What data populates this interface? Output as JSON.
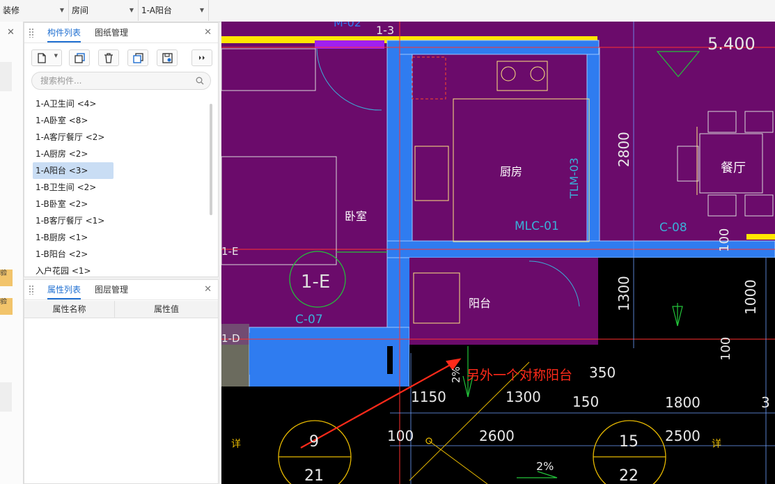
{
  "toolbar": {
    "dropdown1": "装修",
    "dropdown2": "房间",
    "dropdown3": "1-A阳台"
  },
  "left_edge": {
    "tag1": "验",
    "tag2": "验"
  },
  "component_panel": {
    "tab_active": "构件列表",
    "tab_other": "图纸管理",
    "search_placeholder": "搜索构件...",
    "items": [
      "1-A卫生间 <4>",
      "1-A卧室 <8>",
      "1-A客厅餐厅 <2>",
      "1-A厨房 <2>",
      "1-A阳台 <3>",
      "1-B卫生间 <2>",
      "1-B卧室 <2>",
      "1-B客厅餐厅 <1>",
      "1-B厨房 <1>",
      "1-B阳台 <2>",
      "入户花园 <1>"
    ],
    "selected_index": 4
  },
  "property_panel": {
    "tab_active": "属性列表",
    "tab_other": "图层管理",
    "col_name": "属性名称",
    "col_value": "属性值"
  },
  "drawing": {
    "labels": {
      "axis_13": "1-3",
      "axis_1e": "1-E",
      "axis_1d": "1-D",
      "circle_1e": "1-E",
      "elev": "5.400",
      "bedroom": "卧室",
      "kitchen": "厨房",
      "dining": "餐厅",
      "balcony": "阳台",
      "door_mlc": "MLC-01",
      "door_tlm": "TLM-03",
      "window_c08": "C-08",
      "window_c07": "C-07",
      "dim_2800": "2800",
      "dim_1300v": "1300",
      "dim_1000": "1000",
      "dim_100a": "100",
      "dim_100b": "100",
      "dim_350": "350",
      "dim_1150": "1150",
      "dim_1300": "1300",
      "dim_150": "150",
      "dim_1800": "1800",
      "dim_100c": "100",
      "dim_2600": "2600",
      "dim_2500": "2500",
      "slope1": "2%",
      "slope2": "2%",
      "detail_9": "9",
      "detail_21": "21",
      "detail_15": "15",
      "detail_22": "22",
      "xiang1": "详",
      "xiang2": "详",
      "top_partial": "M-02",
      "edge_3": "3",
      "annotation": "另外一个对称阳台"
    }
  },
  "colors": {
    "accent": "#1f6fd1",
    "selected_bg": "#c9ddf4",
    "room_fill": "#6b0b6b",
    "wall_blue": "#2f7cf0",
    "annotation_red": "#ff2a1a",
    "cad_bg": "#000000"
  }
}
